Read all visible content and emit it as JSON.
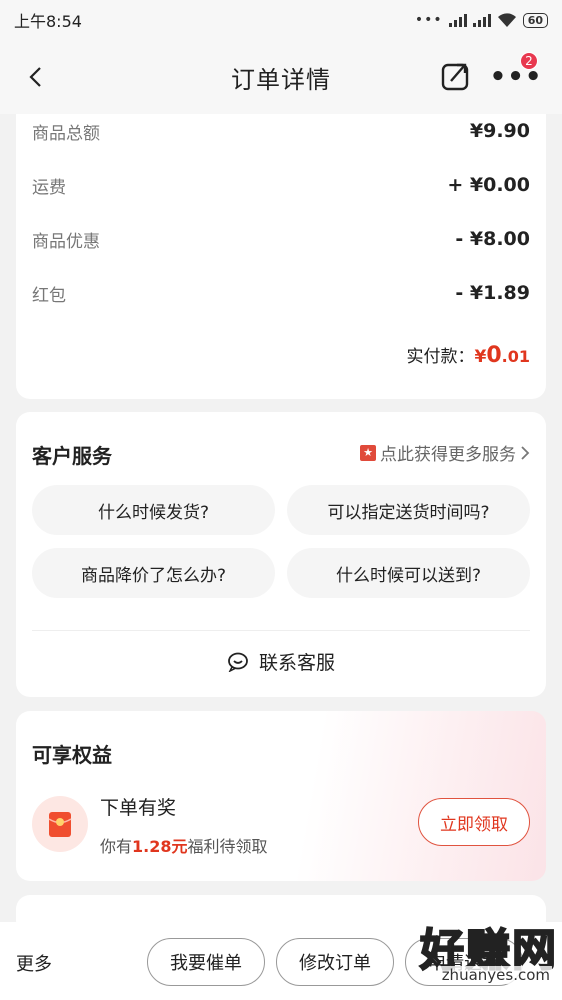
{
  "status": {
    "time": "上午8:54",
    "battery": "60"
  },
  "nav": {
    "title": "订单详情",
    "badge_count": "2"
  },
  "price": {
    "rows": [
      {
        "label": "商品总额",
        "value": "¥9.90"
      },
      {
        "label": "运费",
        "value": "+ ¥0.00"
      },
      {
        "label": "商品优惠",
        "value": "- ¥8.00"
      },
      {
        "label": "红包",
        "value": "- ¥1.89"
      }
    ],
    "total_label": "实付款：",
    "total_yen": "¥",
    "total_int": "0",
    "total_dec": ".01"
  },
  "service": {
    "title": "客户服务",
    "more_link": "点此获得更多服务",
    "faqs": [
      "什么时候发货?",
      "可以指定送货时间吗?",
      "商品降价了怎么办?",
      "什么时候可以送到?"
    ],
    "contact": "联系客服"
  },
  "benefits": {
    "title": "可享权益",
    "name": "下单有奖",
    "desc_prefix": "你有",
    "desc_amount": "1.28元",
    "desc_suffix": "福利待领取",
    "button": "立即领取"
  },
  "bottom": {
    "more": "更多",
    "urge": "我要催单",
    "modify": "修改订单",
    "refund": "申请退款"
  },
  "watermark": {
    "big": "好赚网",
    "small": "zhuanyes.com"
  },
  "colors": {
    "accent": "#e0361e",
    "badge": "#e8384f"
  }
}
